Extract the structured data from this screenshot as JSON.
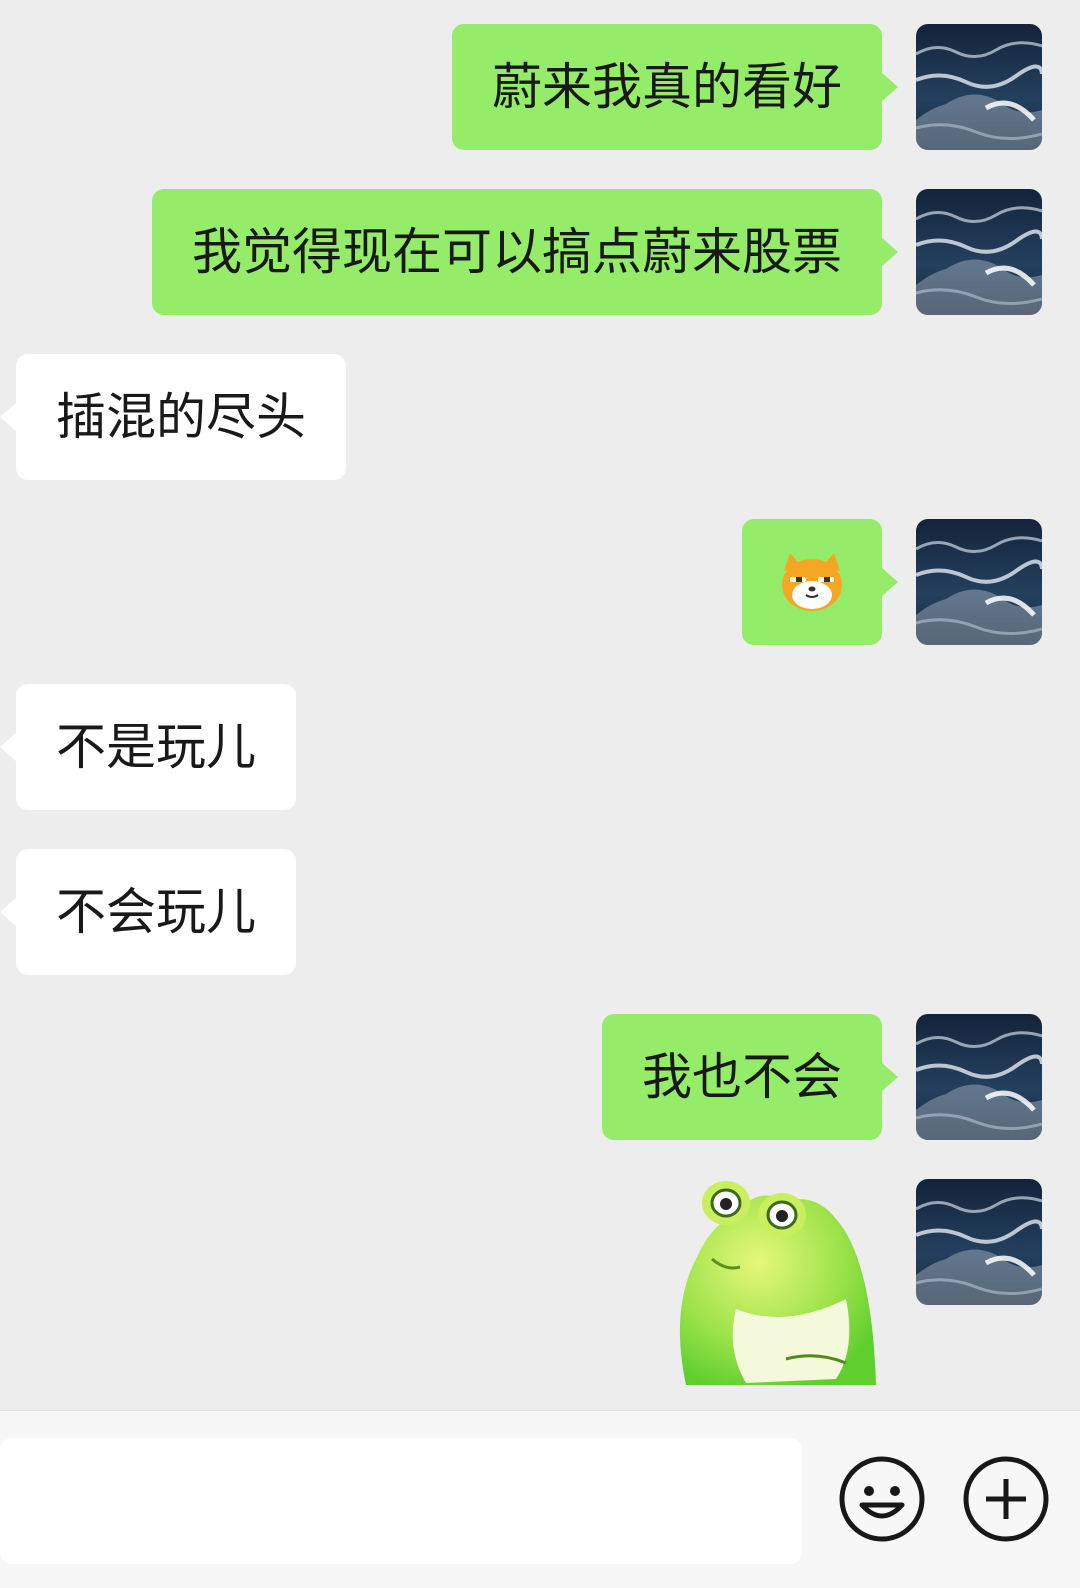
{
  "messages": [
    {
      "side": "out",
      "type": "text",
      "text": "蔚来我真的看好"
    },
    {
      "side": "out",
      "type": "text",
      "text": "我觉得现在可以搞点蔚来股票"
    },
    {
      "side": "in",
      "type": "text",
      "text": "插混的尽头"
    },
    {
      "side": "out",
      "type": "emoji",
      "emoji": "shiba-dog-emoji"
    },
    {
      "side": "in",
      "type": "text",
      "text": "不是玩儿"
    },
    {
      "side": "in",
      "type": "text",
      "text": "不会玩儿"
    },
    {
      "side": "out",
      "type": "text",
      "text": "我也不会"
    },
    {
      "side": "out",
      "type": "sticker",
      "sticker": "green-frog-sticker"
    }
  ],
  "avatar": {
    "name": "ocean-waves-avatar"
  },
  "input_bar": {
    "value": "",
    "emoji_icon": "smiley-face-icon",
    "more_icon": "plus-circle-icon"
  },
  "colors": {
    "background": "#ededed",
    "outgoing_bubble": "#95ec69",
    "incoming_bubble": "#ffffff",
    "text": "#191919",
    "input_bar": "#f7f7f7"
  }
}
